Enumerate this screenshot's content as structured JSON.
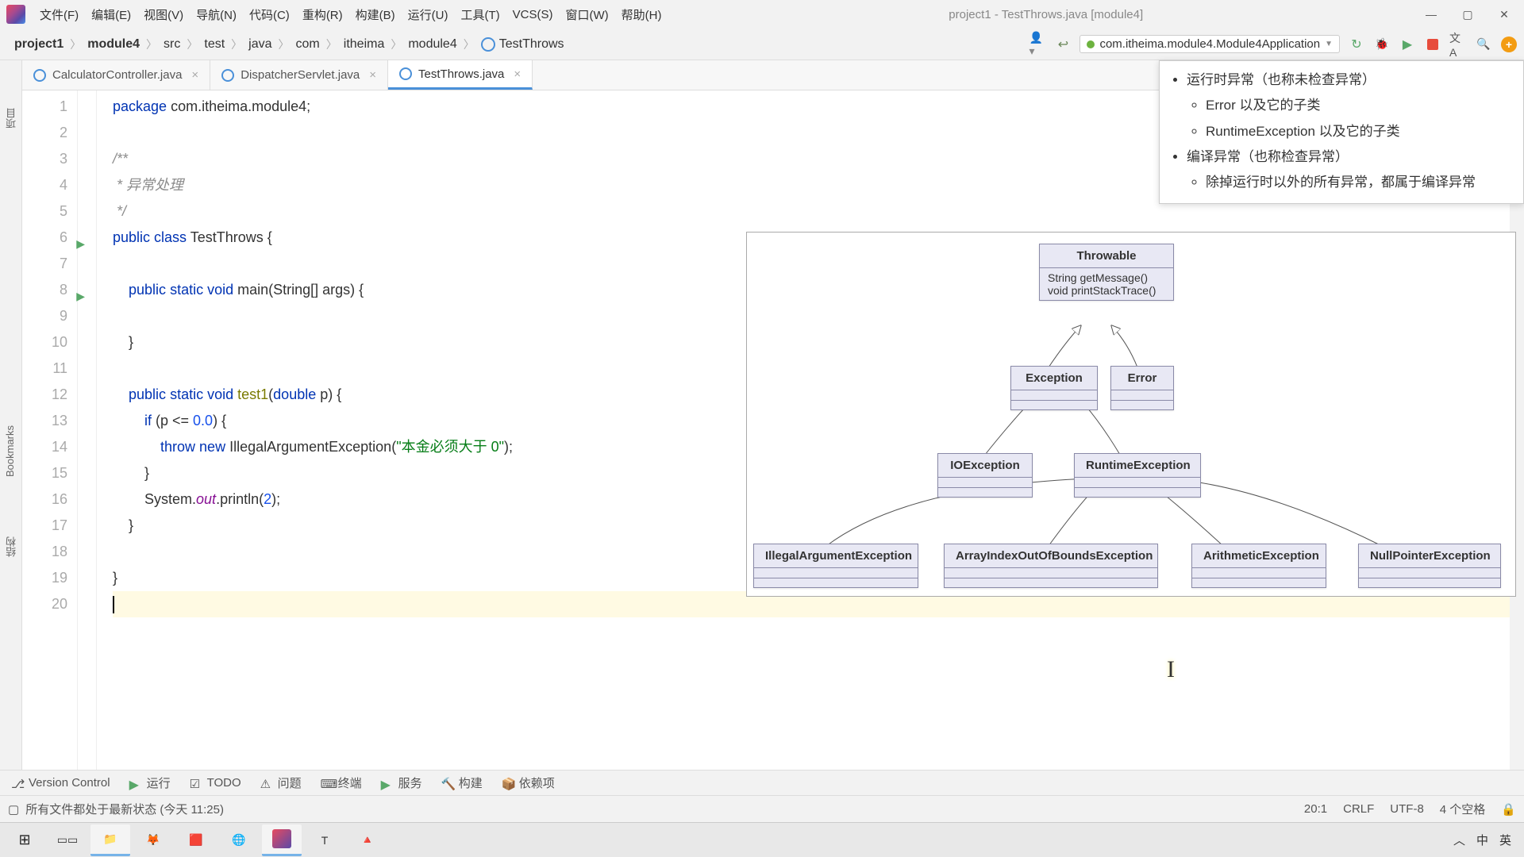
{
  "window": {
    "title": "project1 - TestThrows.java [module4]"
  },
  "menu": {
    "file": "文件(F)",
    "edit": "编辑(E)",
    "view": "视图(V)",
    "navigate": "导航(N)",
    "code": "代码(C)",
    "refactor": "重构(R)",
    "build": "构建(B)",
    "run": "运行(U)",
    "tools": "工具(T)",
    "vcs": "VCS(S)",
    "window": "窗口(W)",
    "help": "帮助(H)"
  },
  "breadcrumbs": [
    "project1",
    "module4",
    "src",
    "test",
    "java",
    "com",
    "itheima",
    "module4",
    "TestThrows"
  ],
  "run_config": "com.itheima.module4.Module4Application",
  "tabs": [
    {
      "label": "CalculatorController.java",
      "active": false
    },
    {
      "label": "DispatcherServlet.java",
      "active": false
    },
    {
      "label": "TestThrows.java",
      "active": true
    }
  ],
  "code": {
    "lines": [
      {
        "n": 1,
        "html": "<span class='kw'>package</span> com.itheima.module4;"
      },
      {
        "n": 2,
        "html": ""
      },
      {
        "n": 3,
        "html": "<span class='cmt'>/**</span>"
      },
      {
        "n": 4,
        "html": "<span class='cmt'> * </span><span class='cmt-it'>异常处理</span>"
      },
      {
        "n": 5,
        "html": "<span class='cmt'> */</span>"
      },
      {
        "n": 6,
        "html": "<span class='kw'>public</span> <span class='kw'>class</span> TestThrows {",
        "run": true
      },
      {
        "n": 7,
        "html": ""
      },
      {
        "n": 8,
        "html": "    <span class='kw'>public</span> <span class='kw'>static</span> <span class='kw'>void</span> main(String[] args) {",
        "run": true
      },
      {
        "n": 9,
        "html": ""
      },
      {
        "n": 10,
        "html": "    }"
      },
      {
        "n": 11,
        "html": ""
      },
      {
        "n": 12,
        "html": "    <span class='kw'>public</span> <span class='kw'>static</span> <span class='kw'>void</span> <span class='method-u'>test1</span>(<span class='kw'>double</span> p) {"
      },
      {
        "n": 13,
        "html": "        <span class='kw'>if</span> (p &lt;= <span class='num'>0.0</span>) {"
      },
      {
        "n": 14,
        "html": "            <span class='kw'>throw</span> <span class='kw'>new</span> IllegalArgumentException(<span class='str'>\"本金必须大于 0\"</span>);"
      },
      {
        "n": 15,
        "html": "        }"
      },
      {
        "n": 16,
        "html": "        System.<span class='static-f'>out</span>.println(<span class='num'>2</span>);"
      },
      {
        "n": 17,
        "html": "    }"
      },
      {
        "n": 18,
        "html": ""
      },
      {
        "n": 19,
        "html": "}"
      },
      {
        "n": 20,
        "html": "<span class='caret'></span>",
        "caret": true
      }
    ]
  },
  "doc_popup": {
    "b1": "运行时异常（也称未检查异常）",
    "s1": "Error 以及它的子类",
    "s2": "RuntimeException 以及它的子类",
    "b2": "编译异常（也称检查异常）",
    "s3": "除掉运行时以外的所有异常，都属于编译异常"
  },
  "diagram": {
    "throwable": "Throwable",
    "m1": "String getMessage()",
    "m2": "void printStackTrace()",
    "exception": "Exception",
    "error": "Error",
    "io": "IOException",
    "rt": "RuntimeException",
    "iae": "IllegalArgumentException",
    "aiobe": "ArrayIndexOutOfBoundsException",
    "ae": "ArithmeticException",
    "npe": "NullPointerException"
  },
  "left_labels": {
    "project": "项目",
    "bookmarks": "Bookmarks",
    "structure": "结构"
  },
  "bottom": {
    "vc": "Version Control",
    "run": "运行",
    "todo": "TODO",
    "problems": "问题",
    "terminal": "终端",
    "services": "服务",
    "build": "构建",
    "deps": "依赖项"
  },
  "status": {
    "left": "所有文件都处于最新状态 (今天 11:25)",
    "pos": "20:1",
    "sep": "CRLF",
    "enc": "UTF-8",
    "indent": "4 个空格"
  },
  "taskbar": {
    "ime1": "中",
    "ime2": "英"
  }
}
